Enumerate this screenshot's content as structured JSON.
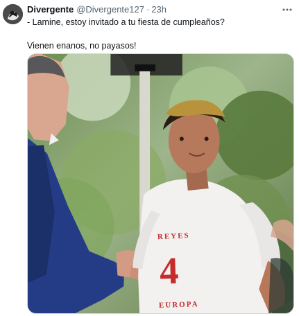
{
  "post": {
    "author": {
      "display_name": "Divergente",
      "handle": "@Divergente127",
      "time": "23h"
    },
    "text": "- Lamine, estoy invitado a tu fiesta de cumpleaños?\n\nVienen enanos, no payasos!",
    "actions": {
      "more_icon": "more-horizontal-icon"
    },
    "media": {
      "type": "photo",
      "shirt_text_top": "REYES",
      "shirt_number": "4",
      "shirt_text_bottom": "EUROPA"
    }
  }
}
